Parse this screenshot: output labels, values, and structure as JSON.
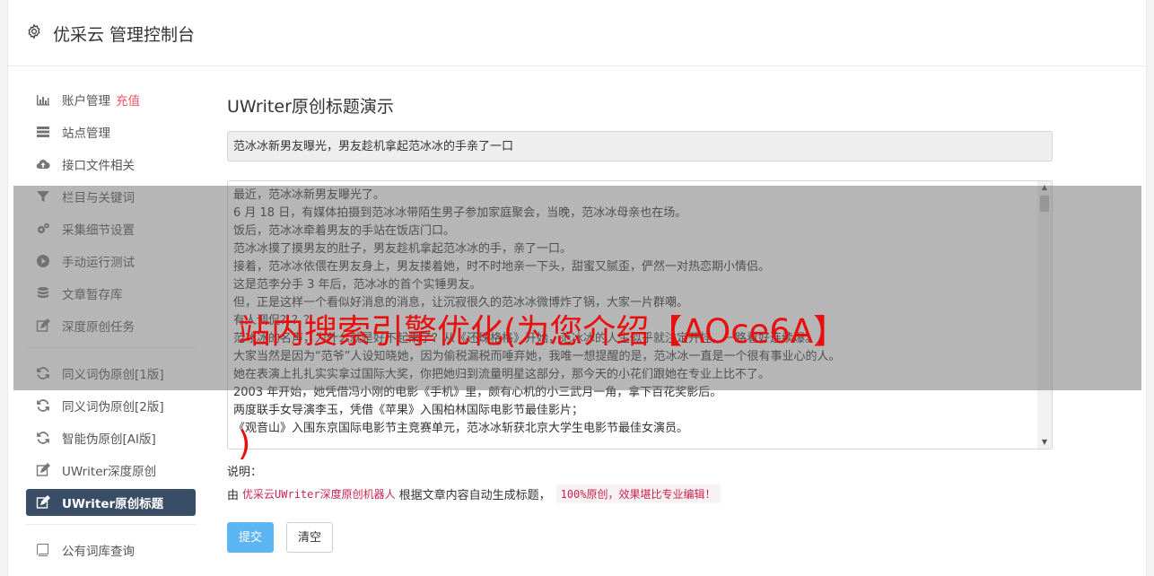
{
  "header": {
    "title": "优采云 管理控制台",
    "icon": "gear-icon"
  },
  "sidebar": {
    "items": [
      {
        "label": "账户管理",
        "tag": "充值",
        "icon": "bar-chart-icon"
      },
      {
        "label": "站点管理",
        "icon": "server-icon"
      },
      {
        "label": "接口文件相关",
        "icon": "cloud-upload-icon"
      },
      {
        "label": "栏目与关键词",
        "icon": "filter-icon"
      },
      {
        "label": "采集细节设置",
        "icon": "cogs-icon"
      },
      {
        "label": "手动运行测试",
        "icon": "play-circle-icon"
      },
      {
        "label": "文章暂存库",
        "icon": "database-icon"
      },
      {
        "label": "深度原创任务",
        "icon": "edit-icon"
      },
      {
        "label": "同义词伪原创[1版]",
        "icon": "refresh-icon"
      },
      {
        "label": "同义词伪原创[2版]",
        "icon": "refresh-icon"
      },
      {
        "label": "智能伪原创[AI版]",
        "icon": "refresh-icon"
      },
      {
        "label": "UWriter深度原创",
        "icon": "edit-icon"
      },
      {
        "label": "UWriter原创标题",
        "icon": "edit-icon",
        "active": true
      },
      {
        "label": "公有词库查询",
        "icon": "book-icon"
      }
    ]
  },
  "main": {
    "heading": "UWriter原创标题演示",
    "title_value": "范冰冰新男友曝光，男友趁机拿起范冰冰的手亲了一口",
    "content_lines": [
      "最近，范冰冰新男友曝光了。",
      "6 月 18 日，有媒体拍摄到范冰冰带陌生男子参加家庭聚会，当晚，范冰冰母亲也在场。",
      "饭后，范冰冰牵着男友的手站在饭店门口。",
      "范冰冰摸了摸男友的肚子，男友趁机拿起范冰冰的手，亲了一口。",
      "接着，范冰冰依偎在男友身上，男友搂着她，时不时地亲一下头，甜蜜又腻歪，俨然一对热恋期小情侣。",
      "这是范李分手 3 年后，范冰冰的首个实锤男友。",
      "但，正是这样一个看似好消息的消息，让沉寂很久的范冰冰微博炸了锅，大家一片群嘲。",
      "有人调侃？？？",
      "范冰冰的名声，为什么就是好不起来了？从《还珠格格》开始，范冰冰的人生似乎就注定开挂，一路看好连续爆。",
      "大家当然是因为“范爷”人设知晓她，因为偷税漏税而唾弃她，我唯一想提醒的是，范冰冰一直是一个很有事业心的人。",
      "她在表演上扎扎实实拿过国际大奖，你把她归到流量明星这部分，那今天的小花们跟她在专业上比不了。",
      "2003 年开始，她凭借冯小刚的电影《手机》里，颇有心机的小三武月一角，拿下百花奖影后。",
      "两度联手女导演李玉，凭借《苹果》入围柏林国际电影节最佳影片；",
      "《观音山》入围东京国际电影节主竞赛单元，范冰冰斩获北京大学生电影节最佳女演员。"
    ],
    "note_label": "说明：",
    "note_prefix": "由",
    "note_code1": "优采云UWriter深度原创机器人",
    "note_middle": "根据文章内容自动生成标题，",
    "note_code2": "100%原创，效果堪比专业编辑！",
    "submit_label": "提交",
    "clear_label": "清空"
  },
  "overlay": {
    "headline": "站内搜索引擎优化(为您介绍【AOce6A】",
    "headline_tail": ")"
  }
}
